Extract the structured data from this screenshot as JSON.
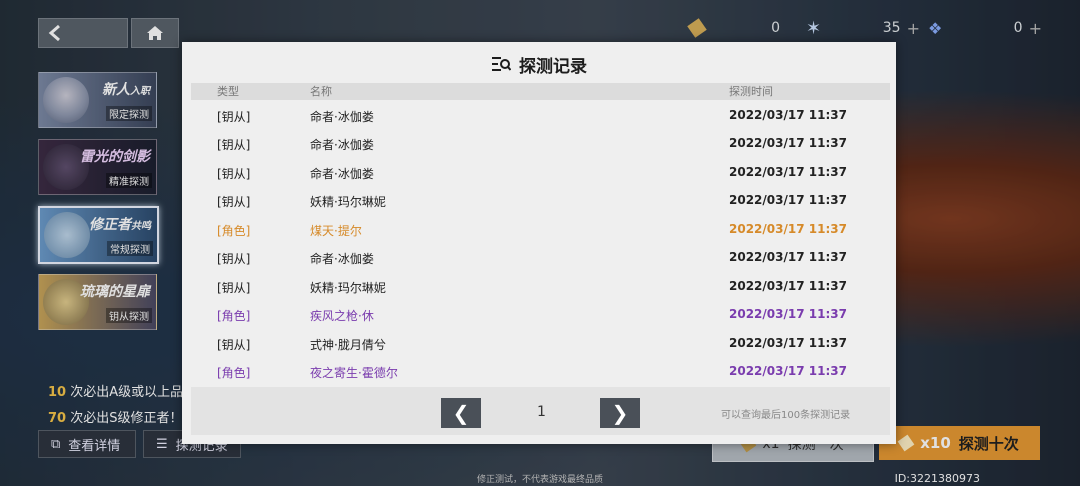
{
  "resources": [
    {
      "icon": "ticket-icon",
      "value": "0"
    },
    {
      "icon": "crystal-icon",
      "value": "35"
    },
    {
      "icon": "gem-icon",
      "value": "0"
    }
  ],
  "banners": [
    {
      "title": "新人",
      "title_suffix": "入职",
      "subtitle": "限定探测"
    },
    {
      "title": "雷光的剑影",
      "subtitle": "精准探测"
    },
    {
      "title": "修正者",
      "title_suffix": "共鸣",
      "subtitle": "常规探测"
    },
    {
      "title": "琉璃的星扉",
      "subtitle": "钥从探测"
    }
  ],
  "info": {
    "line1_num": "10",
    "line1_text": "次必出A级或以上品质修正者",
    "line2_num": "70",
    "line2_text": "次必出S级修正者！！"
  },
  "buttons": {
    "details": "查看详情",
    "records": "探测记录",
    "pull1_count": "x1",
    "pull1_label": "探测一次",
    "pull10_count": "x10",
    "pull10_label": "探测十次"
  },
  "footer": {
    "note": "修正测试，不代表游戏最终品质",
    "uid": "ID:3221380973"
  },
  "modal": {
    "title": "探测记录",
    "columns": {
      "type": "类型",
      "name": "名称",
      "time": "探测时间"
    },
    "rows": [
      {
        "type": "[钥从]",
        "name": "命者·冰伽娄",
        "time": "2022/03/17 11:37",
        "rarity": "normal"
      },
      {
        "type": "[钥从]",
        "name": "命者·冰伽娄",
        "time": "2022/03/17 11:37",
        "rarity": "normal"
      },
      {
        "type": "[钥从]",
        "name": "命者·冰伽娄",
        "time": "2022/03/17 11:37",
        "rarity": "normal"
      },
      {
        "type": "[钥从]",
        "name": "妖精·玛尔琳妮",
        "time": "2022/03/17 11:37",
        "rarity": "normal"
      },
      {
        "type": "[角色]",
        "name": "煤天·提尔",
        "time": "2022/03/17 11:37",
        "rarity": "orange"
      },
      {
        "type": "[钥从]",
        "name": "命者·冰伽娄",
        "time": "2022/03/17 11:37",
        "rarity": "normal"
      },
      {
        "type": "[钥从]",
        "name": "妖精·玛尔琳妮",
        "time": "2022/03/17 11:37",
        "rarity": "normal"
      },
      {
        "type": "[角色]",
        "name": "疾风之枪·休",
        "time": "2022/03/17 11:37",
        "rarity": "purple"
      },
      {
        "type": "[钥从]",
        "name": "式神·胧月倩兮",
        "time": "2022/03/17 11:37",
        "rarity": "normal"
      },
      {
        "type": "[角色]",
        "name": "夜之寄生·霍德尔",
        "time": "2022/03/17 11:37",
        "rarity": "purple"
      }
    ],
    "pager": {
      "page": "1",
      "prev": "❮",
      "next": "❯",
      "note": "可以查询最后100条探测记录"
    }
  },
  "colors": {
    "orange_rarity": "#d68a29",
    "purple_rarity": "#7a3cae",
    "accent_pull10": "#e89a34"
  }
}
